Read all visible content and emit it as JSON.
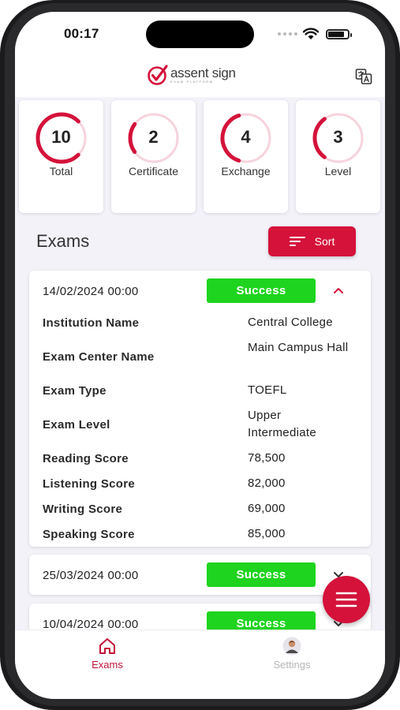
{
  "status_bar": {
    "time": "00:17"
  },
  "header": {
    "logo_text": "assent sign",
    "logo_subtext": "EXAM PLATFORM"
  },
  "stats": [
    {
      "value": "10",
      "label": "Total",
      "progress": 0.75
    },
    {
      "value": "2",
      "label": "Certificate",
      "progress": 0.2
    },
    {
      "value": "4",
      "label": "Exchange",
      "progress": 0.4
    },
    {
      "value": "3",
      "label": "Level",
      "progress": 0.3
    }
  ],
  "exams_section": {
    "title": "Exams",
    "sort_label": "Sort"
  },
  "exams": [
    {
      "date": "14/02/2024 00:00",
      "status": "Success",
      "expanded": true,
      "details": [
        {
          "label": "Institution Name",
          "value": "Central College"
        },
        {
          "label": "Exam Center Name",
          "value": "Main Campus Hall"
        },
        {
          "label": "Exam Type",
          "value": "TOEFL"
        },
        {
          "label": "Exam Level",
          "value": "Upper Intermediate"
        },
        {
          "label": "Reading Score",
          "value": "78,500"
        },
        {
          "label": "Listening Score",
          "value": "82,000"
        },
        {
          "label": "Writing Score",
          "value": "69,000"
        },
        {
          "label": "Speaking Score",
          "value": "85,000"
        }
      ]
    },
    {
      "date": "25/03/2024 00:00",
      "status": "Success",
      "expanded": false
    },
    {
      "date": "10/04/2024 00:00",
      "status": "Success",
      "expanded": false
    }
  ],
  "bottom_nav": [
    {
      "label": "Exams",
      "icon": "home-icon",
      "active": true
    },
    {
      "label": "Settings",
      "icon": "avatar-icon",
      "active": false
    }
  ],
  "colors": {
    "accent": "#d4123a",
    "success": "#1ed41e",
    "ring_track": "#f6d3dc"
  }
}
